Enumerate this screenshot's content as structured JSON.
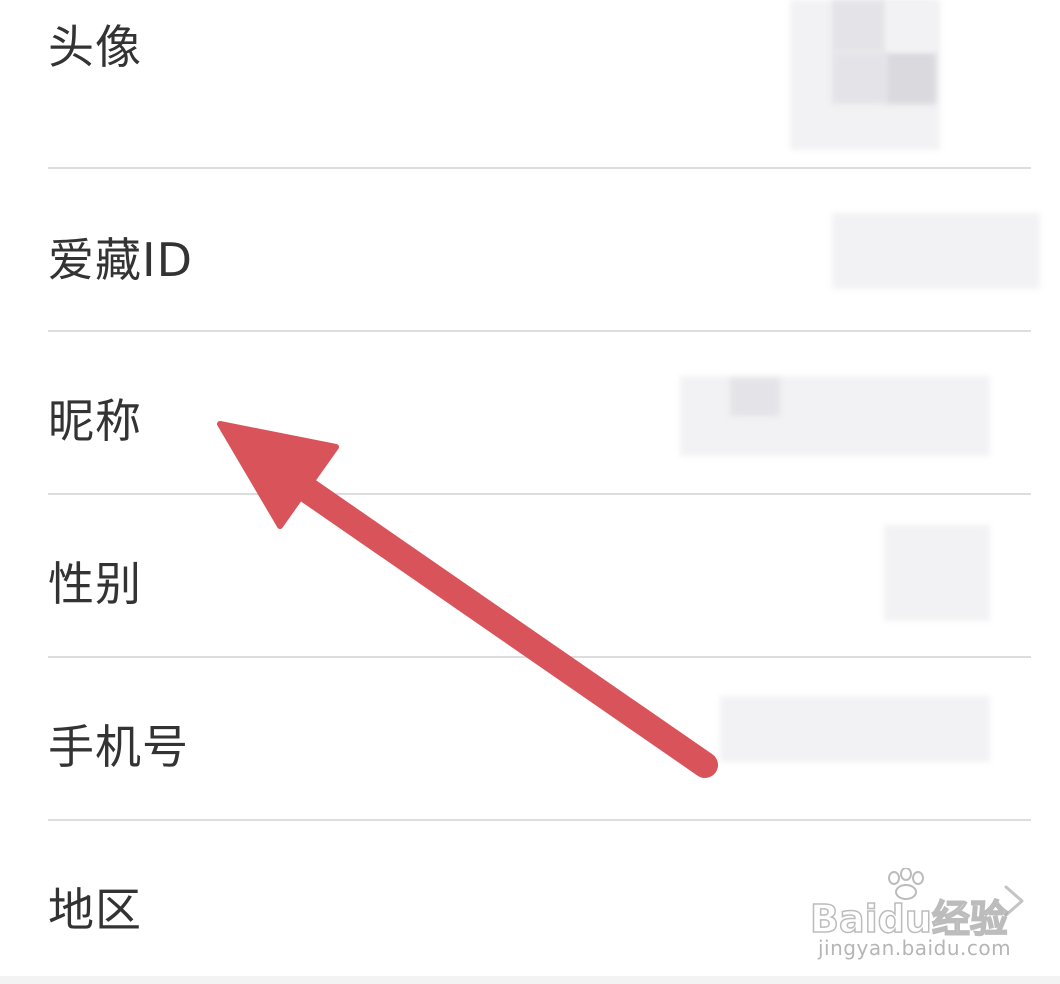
{
  "profile_list": {
    "items": [
      {
        "label": "头像"
      },
      {
        "label": "爱藏ID"
      },
      {
        "label": "昵称"
      },
      {
        "label": "性别"
      },
      {
        "label": "手机号"
      },
      {
        "label": "地区"
      }
    ]
  },
  "icons": {
    "row_arrow": "chevron-right-icon",
    "annotation": "red-arrow-annotation"
  },
  "colors": {
    "annotation_arrow": "#d9535b",
    "divider": "#dddddd",
    "label_text": "#333333"
  },
  "watermark": {
    "main": "Baidu经验",
    "sub": "jingyan.baidu.com"
  }
}
